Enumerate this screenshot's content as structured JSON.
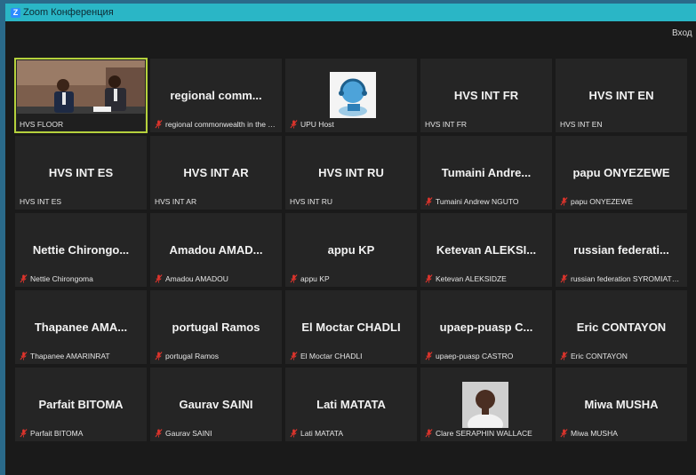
{
  "window": {
    "title": "Zoom Конференция",
    "login_button": "Вход"
  },
  "colors": {
    "active_speaker_border": "#b5d13c",
    "muted_mic": "#e0342c",
    "tile_bg": "#252525"
  },
  "tiles": [
    {
      "name": "",
      "label": "HVS FLOOR",
      "muted": false,
      "type": "video"
    },
    {
      "name": "regional  comm...",
      "label": "regional commonwealth in the fiel...",
      "muted": true,
      "type": "name"
    },
    {
      "name": "",
      "label": "UPU Host",
      "muted": true,
      "type": "upu-image"
    },
    {
      "name": "HVS INT FR",
      "label": "HVS INT FR",
      "muted": false,
      "type": "name"
    },
    {
      "name": "HVS INT EN",
      "label": "HVS INT EN",
      "muted": false,
      "type": "name"
    },
    {
      "name": "HVS INT ES",
      "label": "HVS INT ES",
      "muted": false,
      "type": "name"
    },
    {
      "name": "HVS INT AR",
      "label": "HVS INT AR",
      "muted": false,
      "type": "name"
    },
    {
      "name": "HVS INT RU",
      "label": "HVS INT RU",
      "muted": false,
      "type": "name"
    },
    {
      "name": "Tumaini  Andre...",
      "label": "Tumaini Andrew NGUTO",
      "muted": true,
      "type": "name"
    },
    {
      "name": "papu ONYEZEWE",
      "label": "papu ONYEZEWE",
      "muted": true,
      "type": "name"
    },
    {
      "name": "Nettie  Chirongo...",
      "label": "Nettie Chirongoma",
      "muted": true,
      "type": "name"
    },
    {
      "name": "Amadou  AMAD...",
      "label": "Amadou AMADOU",
      "muted": true,
      "type": "name"
    },
    {
      "name": "appu KP",
      "label": "appu KP",
      "muted": true,
      "type": "name"
    },
    {
      "name": "Ketevan  ALEKSI...",
      "label": "Ketevan ALEKSIDZE",
      "muted": true,
      "type": "name"
    },
    {
      "name": "russian  federati...",
      "label": "russian federation SYROMIATNIK...",
      "muted": true,
      "type": "name"
    },
    {
      "name": "Thapanee  AMA...",
      "label": "Thapanee AMARINRAT",
      "muted": true,
      "type": "name"
    },
    {
      "name": "portugal Ramos",
      "label": "portugal Ramos",
      "muted": true,
      "type": "name"
    },
    {
      "name": "El Moctar CHADLI",
      "label": "El Moctar CHADLI",
      "muted": true,
      "type": "name"
    },
    {
      "name": "upaep-puasp  C...",
      "label": "upaep-puasp CASTRO",
      "muted": true,
      "type": "name"
    },
    {
      "name": "Eric CONTAYON",
      "label": "Eric CONTAYON",
      "muted": true,
      "type": "name"
    },
    {
      "name": "Parfait BITOMA",
      "label": "Parfait BITOMA",
      "muted": true,
      "type": "name"
    },
    {
      "name": "Gaurav SAINI",
      "label": "Gaurav SAINI",
      "muted": true,
      "type": "name"
    },
    {
      "name": "Lati MATATA",
      "label": "Lati MATATA",
      "muted": true,
      "type": "name"
    },
    {
      "name": "",
      "label": "Clare SERAPHIN WALLACE",
      "muted": true,
      "type": "photo"
    },
    {
      "name": "Miwa MUSHA",
      "label": "Miwa MUSHA",
      "muted": true,
      "type": "name"
    }
  ]
}
